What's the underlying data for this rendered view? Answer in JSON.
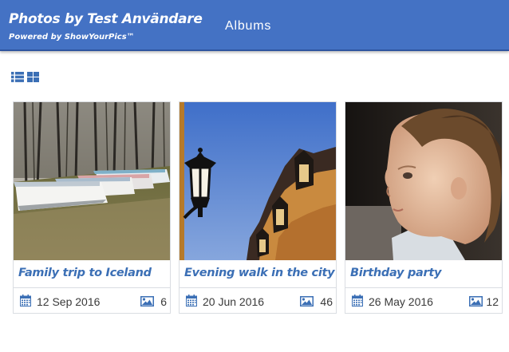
{
  "header": {
    "title": "Photos by Test Användare",
    "subtitle": "Powered by ShowYourPics™",
    "nav_albums": "Albums"
  },
  "view_toggle": {
    "icons": [
      "list-view-icon",
      "grid-view-icon"
    ]
  },
  "albums": [
    {
      "title": "Family trip to Iceland",
      "date": "12 Sep 2016",
      "count": "6",
      "photo": "boats-on-grass"
    },
    {
      "title": "Evening walk in the city",
      "date": "20 Jun 2016",
      "count": "46",
      "photo": "street-lamp-buildings"
    },
    {
      "title": "Birthday party",
      "date": "26 May 2016",
      "count": "12",
      "photo": "child-at-window"
    }
  ],
  "colors": {
    "header_bg": "#4472c4",
    "accent": "#3b6fb5",
    "card_border": "#dadde2"
  }
}
